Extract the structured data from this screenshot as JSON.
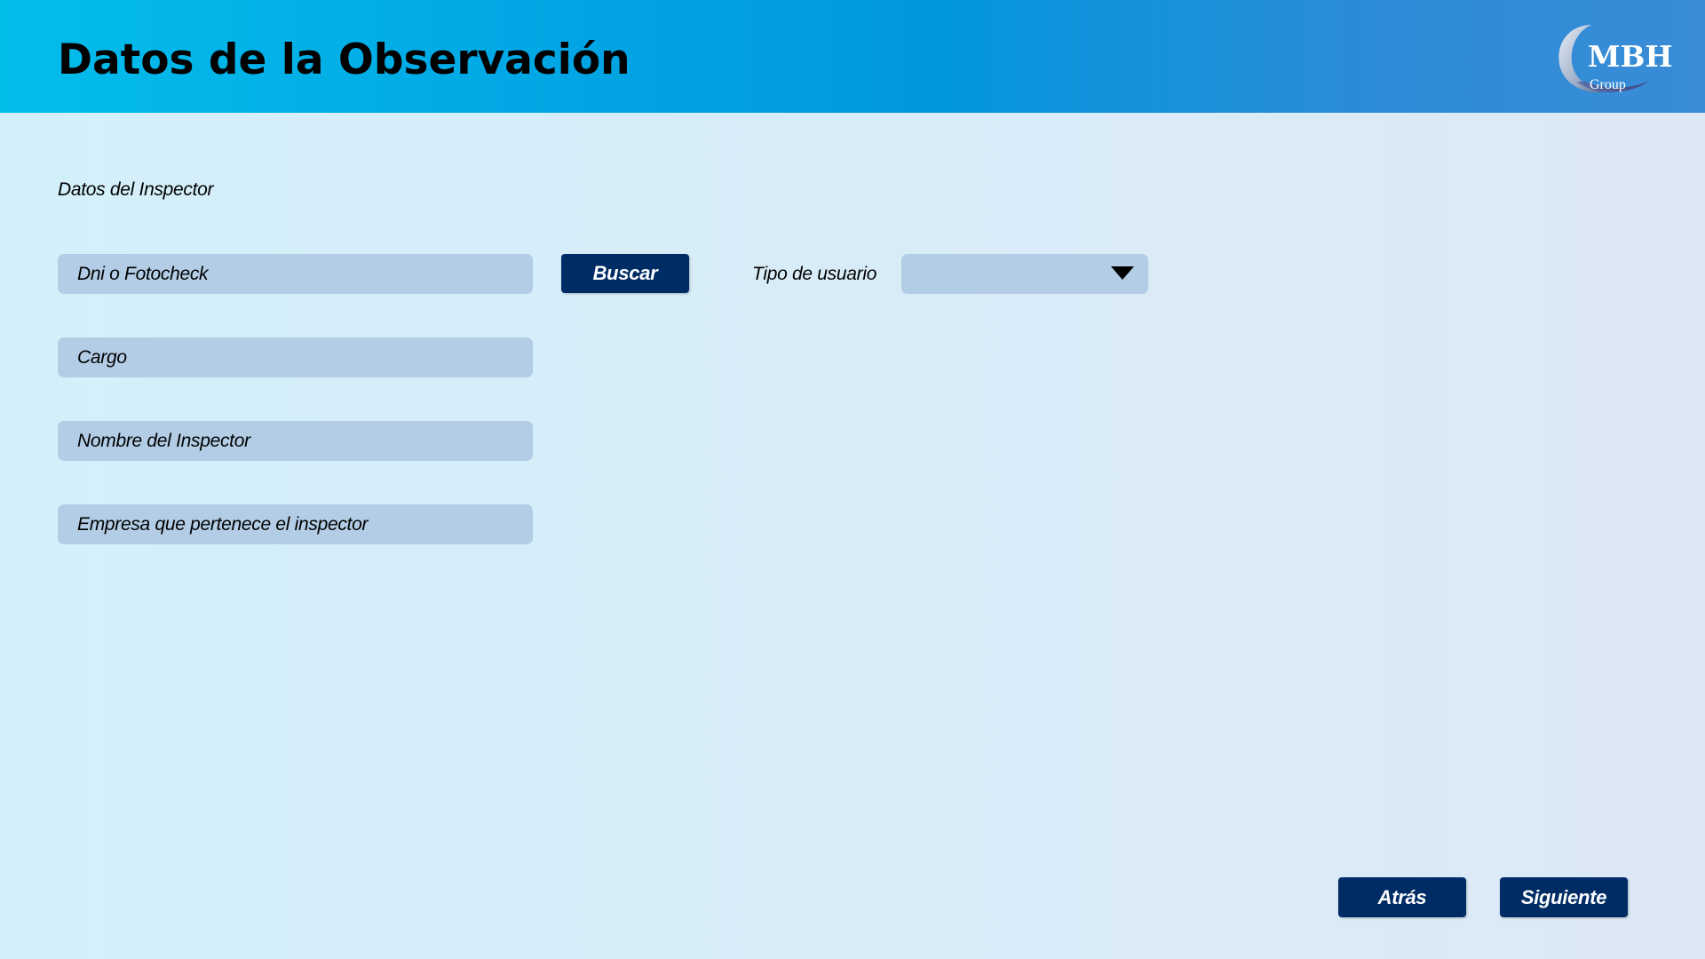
{
  "header": {
    "title": "Datos de la Observación",
    "logo": {
      "text": "MBH",
      "subtext": "Group"
    },
    "gradient_colors": [
      "#03bdeb",
      "#0297dd",
      "#3a8cd6"
    ]
  },
  "form": {
    "section_label": "Datos del Inspector",
    "fields": {
      "dni": "Dni o Fotocheck",
      "cargo": "Cargo",
      "nombre": "Nombre del Inspector",
      "empresa": "Empresa que pertenece el inspector"
    },
    "search_button": "Buscar",
    "user_type": {
      "label": "Tipo de usuario",
      "selected": ""
    }
  },
  "footer": {
    "back_button": "Atrás",
    "next_button": "Siguiente"
  },
  "colors": {
    "field_bg": "#b2cde5",
    "button_bg": "#002c66",
    "page_bg": "#d8ecf8"
  },
  "icons": {
    "select_chevron": "chevron-down-icon",
    "logo": "mbh-logo-icon"
  }
}
